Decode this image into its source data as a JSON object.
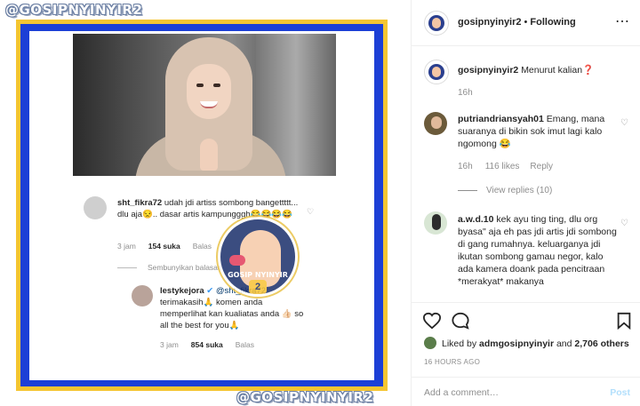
{
  "media": {
    "watermark_top": "@GOSIPNYINYIR2",
    "watermark_bottom": "@GOSIPNYINYIR2",
    "screenshot": {
      "comment1_user": "sht_fikra72",
      "comment1_text": "udah jdi artiss sombong bangettttt... dlu aja😒.. dasar artis kampungggh😂😂😂😂",
      "comment1_time": "3 jam",
      "comment1_likes": "154 suka",
      "comment1_reply": "Balas",
      "hide_replies": "Sembunyikan balasan",
      "reply_user": "lestykejora",
      "reply_mention": "@sht_fikra72",
      "reply_text": "terimakasih🙏 komen anda memperlihat kan kualiatas anda 👍🏻 so all the best for you🙏",
      "reply_time": "3 jam",
      "reply_likes": "854 suka",
      "reply_reply": "Balas"
    },
    "logo": {
      "label": "GOSIP NYINYIR",
      "number": "2"
    }
  },
  "header": {
    "username": "gosipnyinyir2",
    "separator": "•",
    "follow_status": "Following",
    "more_icon": "⋯"
  },
  "caption": {
    "username": "gosipnyinyir2",
    "text": "Menurut kalian❓",
    "time": "16h"
  },
  "comments": [
    {
      "username": "putriandriansyah01",
      "text": "Emang, mana suaranya di bikin sok imut lagi kalo ngomong 😂",
      "time": "16h",
      "likes": "116 likes",
      "reply": "Reply",
      "view_replies": "View replies (10)"
    },
    {
      "username": "a.w.d.10",
      "text": "kek ayu ting ting, dlu org byasa\" aja eh pas jdi artis jdi sombong di gang rumahnya. keluarganya jdi ikutan sombong gamau negor, kalo ada kamera doank pada pencitraan *merakyat* makanya"
    }
  ],
  "actions": {
    "like_icon": "heart-outline",
    "comment_icon": "comment-bubble",
    "save_icon": "bookmark"
  },
  "likes": {
    "prefix": "Liked by",
    "user": "admgosipnyinyir",
    "and": "and",
    "count": "2,706 others"
  },
  "timestamp": "16 HOURS AGO",
  "add_comment": {
    "placeholder": "Add a comment…",
    "post_label": "Post"
  }
}
